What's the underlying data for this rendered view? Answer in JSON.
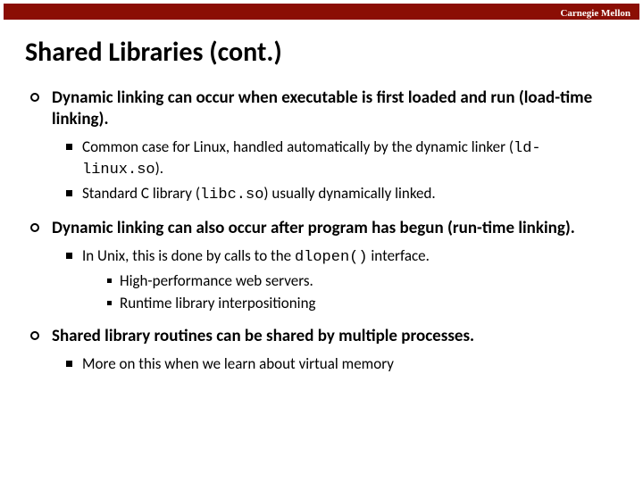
{
  "brand": "Carnegie Mellon",
  "title": "Shared Libraries (cont.)",
  "b1": {
    "text": "Dynamic linking can occur when executable is first loaded and run (load-time linking).",
    "s1a": "Common case for Linux, handled automatically by the dynamic linker (",
    "s1code": "ld-linux.so",
    "s1b": ").",
    "s2a": "Standard C library (",
    "s2code": "libc.so",
    "s2b": ") usually dynamically linked."
  },
  "b2": {
    "text": "Dynamic linking can also occur after program has begun (run-time linking).",
    "s1a": "In Unix, this is done by calls to the ",
    "s1code": "dlopen()",
    "s1b": " interface.",
    "ss1": "High-performance web servers.",
    "ss2": "Runtime library interpositioning"
  },
  "b3": {
    "text": "Shared library routines can be shared by multiple processes.",
    "s1": "More on this when we learn about virtual memory"
  }
}
